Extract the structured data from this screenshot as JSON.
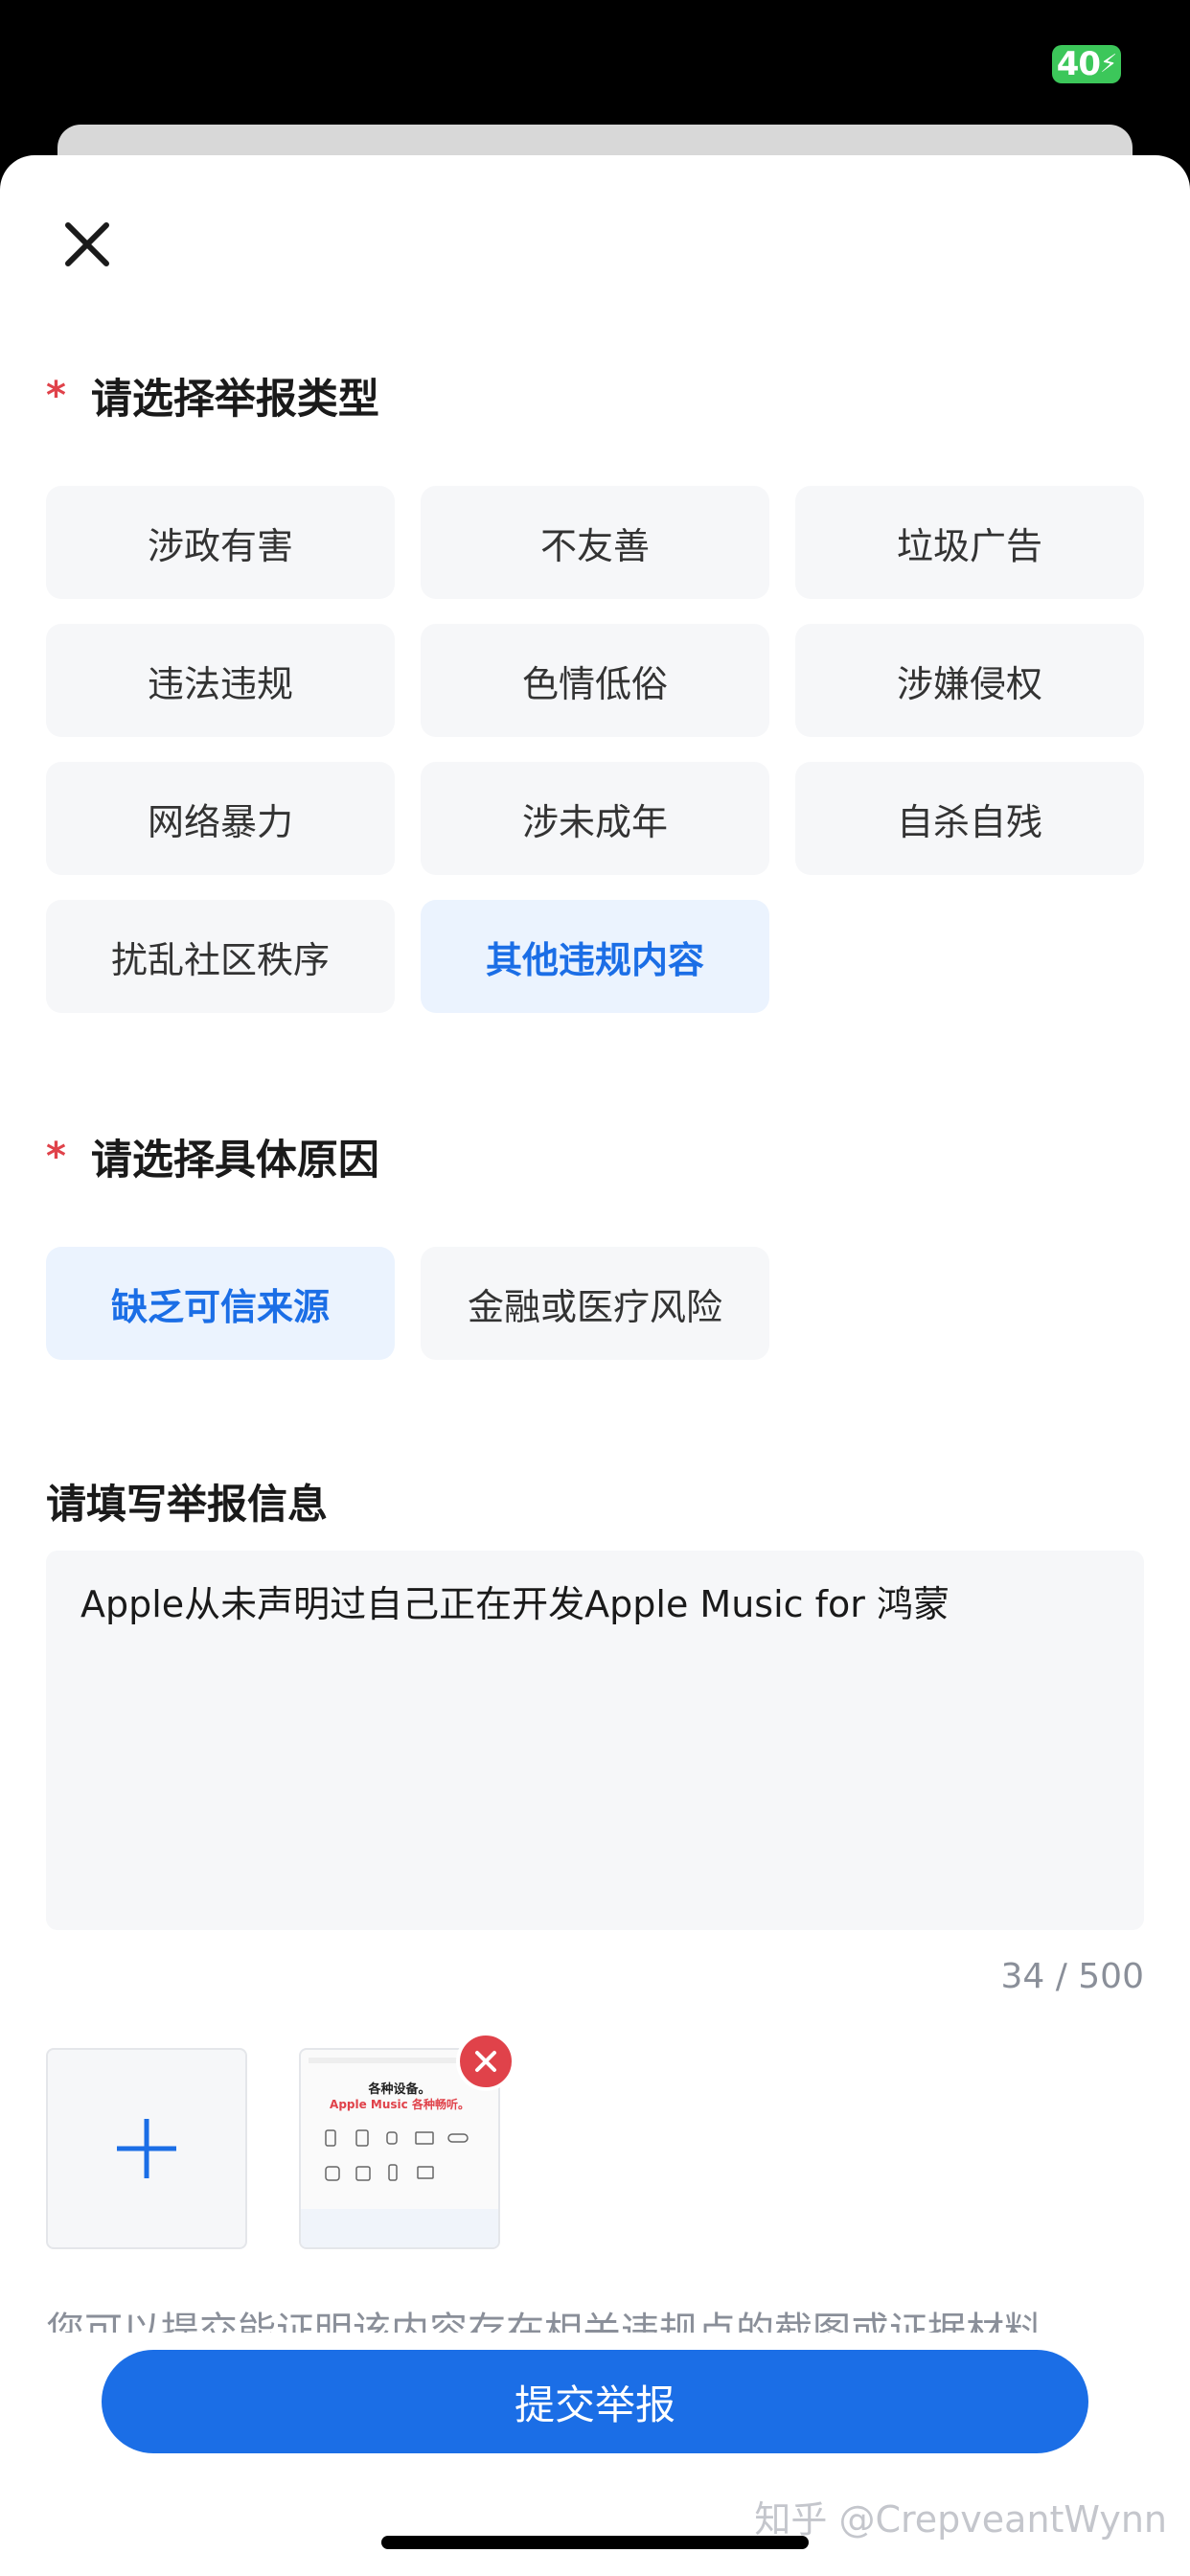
{
  "status_bar": {
    "network_badge": "40",
    "charging_glyph": "⚡"
  },
  "close_icon": "close-icon",
  "report_type": {
    "required_mark": "*",
    "title": "请选择举报类型",
    "options": [
      "涉政有害",
      "不友善",
      "垃圾广告",
      "违法违规",
      "色情低俗",
      "涉嫌侵权",
      "网络暴力",
      "涉未成年",
      "自杀自残",
      "扰乱社区秩序",
      "其他违规内容"
    ],
    "selected": "其他违规内容"
  },
  "reason": {
    "required_mark": "*",
    "title": "请选择具体原因",
    "options": [
      "缺乏可信来源",
      "金融或医疗风险"
    ],
    "selected": "缺乏可信来源"
  },
  "info": {
    "title": "请填写举报信息",
    "value": "Apple从未声明过自己正在开发Apple Music for 鸿蒙",
    "counter": "34 / 500"
  },
  "attachments": {
    "add_icon": "plus-icon",
    "thumbnail": {
      "line1": "各种设备。",
      "line2": "Apple Music 各种畅听。"
    },
    "remove_icon": "remove-icon"
  },
  "hint": "您可以提交能证明该内容存在相关违规点的截图或证据材料",
  "submit_label": "提交举报",
  "watermark": "知乎 @CrepveantWynn",
  "colors": {
    "accent": "#1b6ee6",
    "required": "#e0424a",
    "chip_bg": "#f6f7f9",
    "chip_selected_bg": "#ebf3fe",
    "badge": "#3cc75a"
  }
}
